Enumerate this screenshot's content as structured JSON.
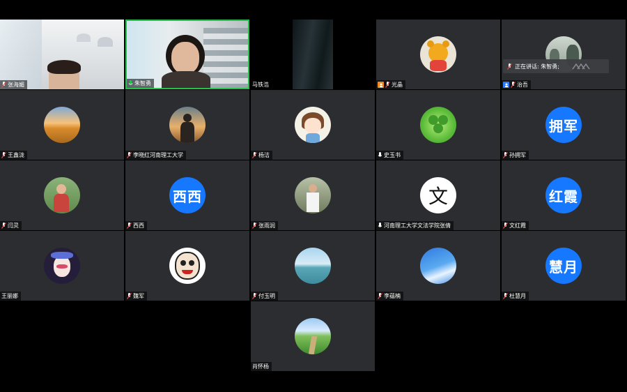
{
  "speaking_indicator": {
    "label": "正在讲话: 朱智勇;"
  },
  "participants": [
    {
      "name": "张海媚",
      "avatar": "video-woman-glasses",
      "mic": "muted"
    },
    {
      "name": "朱智勇",
      "avatar": "video-woman-speaking",
      "mic": "active",
      "active_speaker": true
    },
    {
      "name": "马铁浩",
      "avatar": "video-dark",
      "mic": "none"
    },
    {
      "name": "光晶",
      "avatar": "winnie-the-pooh",
      "mic": "muted",
      "role": "host"
    },
    {
      "name": "治吾",
      "avatar": "misty-landscape",
      "mic": "muted",
      "role": "cohost"
    },
    {
      "name": "王鑫泷",
      "avatar": "sunset-field",
      "mic": "muted"
    },
    {
      "name": "李晓红河南理工大学",
      "avatar": "silhouette-sunset",
      "mic": "muted"
    },
    {
      "name": "杨洁",
      "avatar": "anime-girl",
      "mic": "muted"
    },
    {
      "name": "史玉书",
      "avatar": "clover",
      "mic": "unmuted"
    },
    {
      "name": "孙拥军",
      "avatar_text": "拥军",
      "mic": "muted"
    },
    {
      "name": "闫灵",
      "avatar": "child-outdoors",
      "mic": "muted"
    },
    {
      "name": "西西",
      "avatar_text": "西西",
      "mic": "muted"
    },
    {
      "name": "张雨润",
      "avatar": "man-standing",
      "mic": "muted"
    },
    {
      "name": "河南理工大学文法学院张倩",
      "avatar_text": "文",
      "mic": "unmuted"
    },
    {
      "name": "文红霞",
      "avatar_text": "红霞",
      "mic": "muted"
    },
    {
      "name": "王丽娜",
      "avatar": "opera-mask",
      "mic": "none"
    },
    {
      "name": "魏军",
      "avatar": "cartoon-face",
      "mic": "muted"
    },
    {
      "name": "付玉明",
      "avatar": "sea-horizon",
      "mic": "muted"
    },
    {
      "name": "李蕴楠",
      "avatar": "blue-sky",
      "mic": "muted"
    },
    {
      "name": "杜慧月",
      "avatar_text": "慧月",
      "mic": "muted"
    },
    {
      "name": "肖怀杨",
      "avatar": "green-path",
      "mic": "none"
    }
  ],
  "colors": {
    "tile_bg": "#2b2d30",
    "avatar_blue": "#1677ff",
    "active_border": "#27c24c",
    "muted_red": "#e84a4a"
  }
}
